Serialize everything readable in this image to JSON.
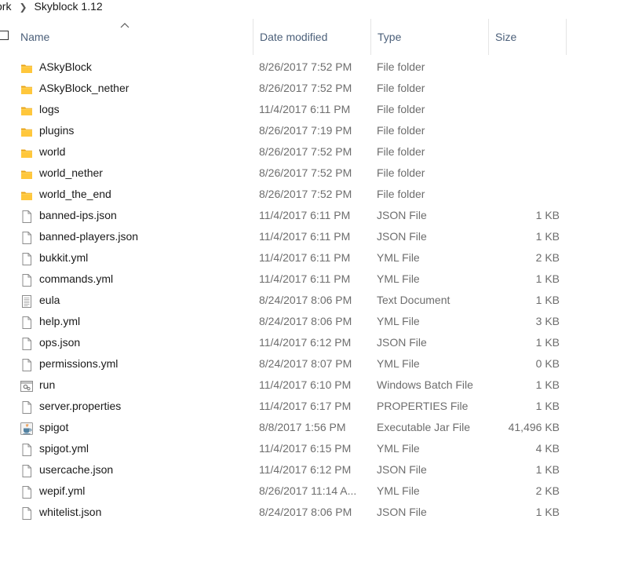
{
  "breadcrumb": {
    "parent": "ork",
    "current": "Skyblock 1.12"
  },
  "columns": {
    "name": "Name",
    "date": "Date modified",
    "type": "Type",
    "size": "Size"
  },
  "colors": {
    "folder": "#ffc73c",
    "header_text": "#4c607a",
    "meta_text": "#6d6d6d"
  },
  "files": [
    {
      "icon": "folder-icon",
      "name": "ASkyBlock",
      "date": "8/26/2017 7:52 PM",
      "type": "File folder",
      "size": ""
    },
    {
      "icon": "folder-icon",
      "name": "ASkyBlock_nether",
      "date": "8/26/2017 7:52 PM",
      "type": "File folder",
      "size": ""
    },
    {
      "icon": "folder-icon",
      "name": "logs",
      "date": "11/4/2017 6:11 PM",
      "type": "File folder",
      "size": ""
    },
    {
      "icon": "folder-icon",
      "name": "plugins",
      "date": "8/26/2017 7:19 PM",
      "type": "File folder",
      "size": ""
    },
    {
      "icon": "folder-icon",
      "name": "world",
      "date": "8/26/2017 7:52 PM",
      "type": "File folder",
      "size": ""
    },
    {
      "icon": "folder-icon",
      "name": "world_nether",
      "date": "8/26/2017 7:52 PM",
      "type": "File folder",
      "size": ""
    },
    {
      "icon": "folder-icon",
      "name": "world_the_end",
      "date": "8/26/2017 7:52 PM",
      "type": "File folder",
      "size": ""
    },
    {
      "icon": "file-icon",
      "name": "banned-ips.json",
      "date": "11/4/2017 6:11 PM",
      "type": "JSON File",
      "size": "1 KB"
    },
    {
      "icon": "file-icon",
      "name": "banned-players.json",
      "date": "11/4/2017 6:11 PM",
      "type": "JSON File",
      "size": "1 KB"
    },
    {
      "icon": "file-icon",
      "name": "bukkit.yml",
      "date": "11/4/2017 6:11 PM",
      "type": "YML File",
      "size": "2 KB"
    },
    {
      "icon": "file-icon",
      "name": "commands.yml",
      "date": "11/4/2017 6:11 PM",
      "type": "YML File",
      "size": "1 KB"
    },
    {
      "icon": "text-document-icon",
      "name": "eula",
      "date": "8/24/2017 8:06 PM",
      "type": "Text Document",
      "size": "1 KB"
    },
    {
      "icon": "file-icon",
      "name": "help.yml",
      "date": "8/24/2017 8:06 PM",
      "type": "YML File",
      "size": "3 KB"
    },
    {
      "icon": "file-icon",
      "name": "ops.json",
      "date": "11/4/2017 6:12 PM",
      "type": "JSON File",
      "size": "1 KB"
    },
    {
      "icon": "file-icon",
      "name": "permissions.yml",
      "date": "8/24/2017 8:07 PM",
      "type": "YML File",
      "size": "0 KB"
    },
    {
      "icon": "batch-file-icon",
      "name": "run",
      "date": "11/4/2017 6:10 PM",
      "type": "Windows Batch File",
      "size": "1 KB"
    },
    {
      "icon": "file-icon",
      "name": "server.properties",
      "date": "11/4/2017 6:17 PM",
      "type": "PROPERTIES File",
      "size": "1 KB"
    },
    {
      "icon": "java-jar-icon",
      "name": "spigot",
      "date": "8/8/2017 1:56 PM",
      "type": "Executable Jar File",
      "size": "41,496 KB"
    },
    {
      "icon": "file-icon",
      "name": "spigot.yml",
      "date": "11/4/2017 6:15 PM",
      "type": "YML File",
      "size": "4 KB"
    },
    {
      "icon": "file-icon",
      "name": "usercache.json",
      "date": "11/4/2017 6:12 PM",
      "type": "JSON File",
      "size": "1 KB"
    },
    {
      "icon": "file-icon",
      "name": "wepif.yml",
      "date": "8/26/2017 11:14 A...",
      "type": "YML File",
      "size": "2 KB"
    },
    {
      "icon": "file-icon",
      "name": "whitelist.json",
      "date": "8/24/2017 8:06 PM",
      "type": "JSON File",
      "size": "1 KB"
    }
  ]
}
